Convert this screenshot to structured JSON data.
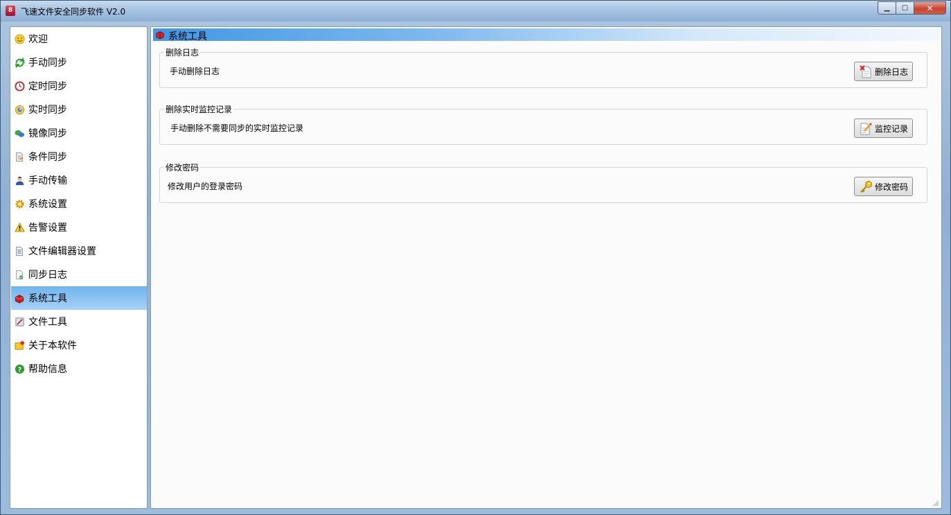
{
  "window": {
    "title": "飞速文件安全同步软件 V2.0"
  },
  "sidebar": {
    "items": [
      {
        "label": "欢迎",
        "icon": "smiley-icon"
      },
      {
        "label": "手动同步",
        "icon": "sync-arrows-icon"
      },
      {
        "label": "定时同步",
        "icon": "clock-icon"
      },
      {
        "label": "实时同步",
        "icon": "realtime-gauge-icon"
      },
      {
        "label": "镜像同步",
        "icon": "mirror-icon"
      },
      {
        "label": "条件同步",
        "icon": "condition-doc-icon"
      },
      {
        "label": "手动传输",
        "icon": "user-transfer-icon"
      },
      {
        "label": "系统设置",
        "icon": "gear-icon"
      },
      {
        "label": "告警设置",
        "icon": "warning-icon"
      },
      {
        "label": "文件编辑器设置",
        "icon": "file-editor-icon"
      },
      {
        "label": "同步日志",
        "icon": "log-doc-icon"
      },
      {
        "label": "系统工具",
        "icon": "toolbox-icon",
        "active": true
      },
      {
        "label": "文件工具",
        "icon": "file-tool-icon"
      },
      {
        "label": "关于本软件",
        "icon": "about-icon"
      },
      {
        "label": "帮助信息",
        "icon": "help-icon"
      }
    ]
  },
  "main": {
    "header": {
      "title": "系统工具"
    },
    "groups": [
      {
        "legend": "删除日志",
        "description": "手动删除日志",
        "button": "删除日志"
      },
      {
        "legend": "删除实时监控记录",
        "description": "手动删除不需要同步的实时监控记录",
        "button": "监控记录"
      },
      {
        "legend": "修改密码",
        "description": "修改用户的登录密码",
        "button": "修改密码"
      }
    ]
  },
  "colors": {
    "accent": "#6fb4ee",
    "header_start": "#3f97e6"
  }
}
